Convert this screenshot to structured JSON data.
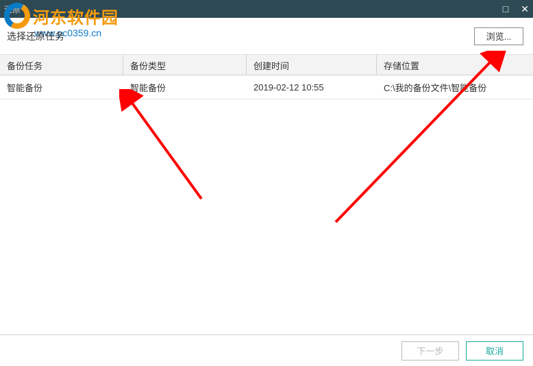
{
  "window": {
    "title": "还原"
  },
  "watermark": {
    "name": "河东软件园",
    "url": "www.pc0359.cn"
  },
  "subheader": {
    "label": "选择还原任务",
    "browse": "浏览..."
  },
  "table": {
    "headers": {
      "task": "备份任务",
      "type": "备份类型",
      "time": "创建时间",
      "location": "存储位置"
    },
    "rows": [
      {
        "task": "智能备份",
        "type": "智能备份",
        "time": "2019-02-12 10:55",
        "location": "C:\\我的备份文件\\智能备份"
      }
    ]
  },
  "footer": {
    "next": "下一步",
    "cancel": "取消"
  }
}
